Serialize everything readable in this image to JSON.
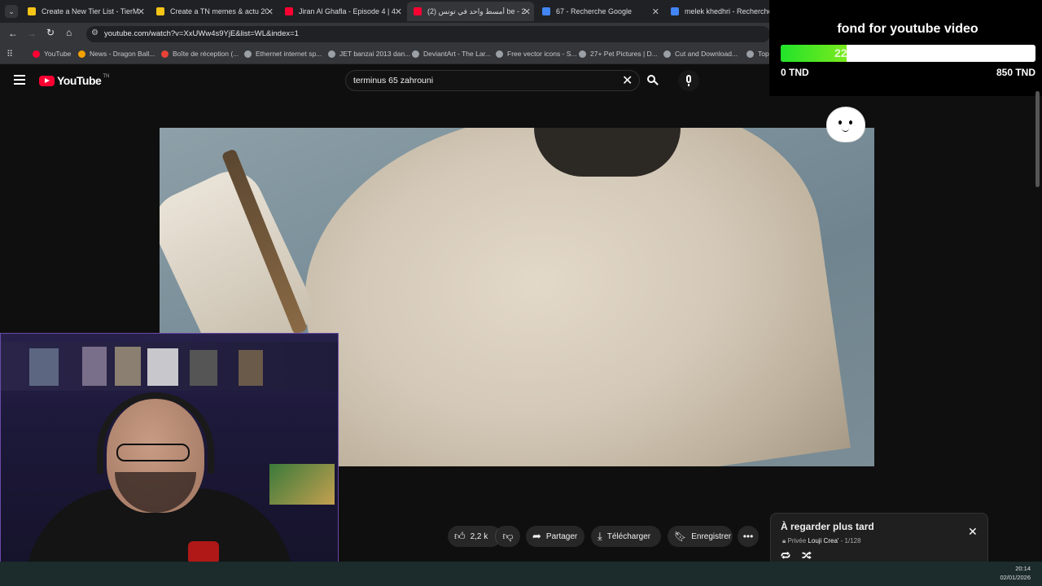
{
  "browser": {
    "tabs": [
      {
        "title": "Create a New Tier List - TierMaker",
        "fav_color": "#f5c518"
      },
      {
        "title": "Create a TN memes & actu 2025",
        "fav_color": "#f5c518"
      },
      {
        "title": "Jiran Al Ghafla - Episode 4 | 4",
        "fav_color": "#ff0033"
      },
      {
        "title": "أمسط واحد في تونس (2) be - 2",
        "fav_color": "#ff0033"
      },
      {
        "title": "67 - Recherche Google",
        "fav_color": "#4285f4"
      },
      {
        "title": "melek khedhri - Recherche Google",
        "fav_color": "#4285f4"
      }
    ],
    "url": "youtube.com/watch?v=XxUWw4s9YjE&list=WL&index=1",
    "bookmarks": [
      {
        "label": "YouTube",
        "color": "#ff0033"
      },
      {
        "label": "News - Dragon Ball...",
        "color": "#f4a100"
      },
      {
        "label": "Boîte de réception (...",
        "color": "#ea4335"
      },
      {
        "label": "Ethernet internet sp...",
        "color": "#9aa0a6"
      },
      {
        "label": "JET banzai 2013 dan...",
        "color": "#9aa0a6"
      },
      {
        "label": "DeviantArt - The Lar...",
        "color": "#9aa0a6"
      },
      {
        "label": "Free vector icons - S...",
        "color": "#9aa0a6"
      },
      {
        "label": "27+ Pet Pictures | D...",
        "color": "#9aa0a6"
      },
      {
        "label": "Cut and Download...",
        "color": "#9aa0a6"
      },
      {
        "label": "Top",
        "color": "#9aa0a6"
      }
    ]
  },
  "youtube": {
    "logo_text": "YouTube",
    "logo_sup": "TN",
    "search_value": "terminus 65 zahrouni",
    "actions": {
      "likes": "2,2 k",
      "share": "Partager",
      "download": "Télécharger",
      "save": "Enregistrer"
    },
    "playlist": {
      "title": "À regarder plus tard",
      "privacy": "Privée",
      "owner": "Louji Crea'",
      "position": "- 1/128"
    }
  },
  "donation": {
    "title": "fond for youtube video",
    "current": "221",
    "progress_fraction": 0.26,
    "min_label": "0 TND",
    "max_label": "850 TND"
  },
  "taskbar": {
    "time": "20:14",
    "date": "02/01/2026"
  },
  "colors": {
    "youtube_red": "#ff0033",
    "donation_bar": "#22e32a"
  }
}
